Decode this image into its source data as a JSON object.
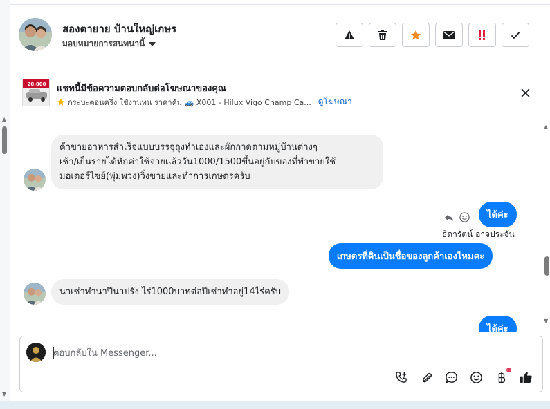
{
  "header": {
    "name": "สองตายาย บ้านใหญ่เกษร",
    "assign_label": "มอบหมายการสนทนานี้",
    "actions": [
      {
        "icon": "warning-icon"
      },
      {
        "icon": "trash-icon"
      },
      {
        "icon": "star-icon"
      },
      {
        "icon": "mail-icon"
      },
      {
        "icon": "urgent-icon"
      },
      {
        "icon": "check-icon"
      }
    ]
  },
  "ad_banner": {
    "title": "แชทนี้มีข้อความตอบกลับต่อโฆษณาของคุณ",
    "description": "กระบะตอนครึ่ง ใช้งานทน ราคาคุ้ม 🚙 X001 - Hilux Vigo Champ Ca...",
    "link": "ดูโฆษณา",
    "thumb_price": "20,000"
  },
  "messages": [
    {
      "direction": "in",
      "lines": [
        "ค้าขายอาหารสำเร็จแบบบรรจุถุงทำเองและผักกาดตามหมู่บ้านต่างๆ",
        "เช้า/เย็นรายได้หักค่าใช้จ่ายแล้ววัน1000/1500ขึ้นอยู่กับของที่ทำขายใช้",
        "มอเตอร์ไซย์(พุ่มพวง)วิ่งขายและทำการเกษตรครับ"
      ]
    },
    {
      "direction": "out",
      "text": "ได้ค่ะ",
      "sender": "ธิดารัตน์ อาจประจัน"
    },
    {
      "direction": "out",
      "text": "เกษตรที่ดินเป็นชื่อของลูกค้าเองไหมคะ"
    },
    {
      "direction": "in",
      "text": "นาเช่าทำนาปีนาปรัง ไร่1000บาทต่อปีเช่าทำอยู่14ไร่ครับ"
    },
    {
      "direction": "out",
      "text": "ได้ค่ะ"
    }
  ],
  "composer": {
    "placeholder": "ตอบกลับใน Messenger...",
    "tools": [
      "call-add-icon",
      "attachment-icon",
      "chat-bubble-icon",
      "emoji-icon",
      "baht-icon",
      "like-icon"
    ]
  }
}
